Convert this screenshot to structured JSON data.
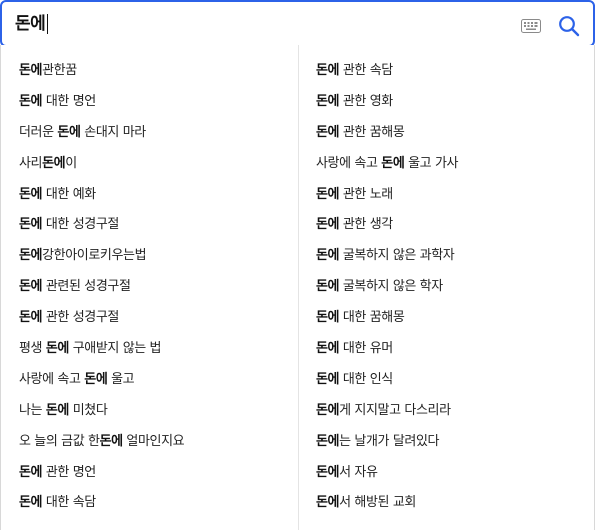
{
  "search": {
    "query": "돈에",
    "keyboard_icon": "keyboard-icon",
    "search_icon": "magnifier-icon",
    "accent_color": "#2c62e8"
  },
  "suggestions": {
    "left": [
      {
        "pre": "",
        "match": "돈에",
        "post": "관한꿈"
      },
      {
        "pre": "",
        "match": "돈에",
        "post": " 대한 명언"
      },
      {
        "pre": "더러운 ",
        "match": "돈에",
        "post": " 손대지 마라"
      },
      {
        "pre": "사리",
        "match": "돈에",
        "post": "이"
      },
      {
        "pre": "",
        "match": "돈에",
        "post": " 대한 예화"
      },
      {
        "pre": "",
        "match": "돈에",
        "post": " 대한 성경구절"
      },
      {
        "pre": "",
        "match": "돈에",
        "post": "강한아이로키우는법"
      },
      {
        "pre": "",
        "match": "돈에",
        "post": " 관련된 성경구절"
      },
      {
        "pre": "",
        "match": "돈에",
        "post": " 관한 성경구절"
      },
      {
        "pre": "평생 ",
        "match": "돈에",
        "post": " 구애받지 않는 법"
      },
      {
        "pre": "사랑에 속고 ",
        "match": "돈에",
        "post": " 울고"
      },
      {
        "pre": "나는 ",
        "match": "돈에",
        "post": " 미쳤다"
      },
      {
        "pre": "오 늘의 금값 한",
        "match": "돈에",
        "post": " 얼마인지요"
      },
      {
        "pre": "",
        "match": "돈에",
        "post": " 관한 명언"
      },
      {
        "pre": "",
        "match": "돈에",
        "post": " 대한 속담"
      }
    ],
    "right": [
      {
        "pre": "",
        "match": "돈에",
        "post": " 관한 속담"
      },
      {
        "pre": "",
        "match": "돈에",
        "post": " 관한 영화"
      },
      {
        "pre": "",
        "match": "돈에",
        "post": " 관한 꿈해몽"
      },
      {
        "pre": "사랑에 속고 ",
        "match": "돈에",
        "post": " 울고 가사"
      },
      {
        "pre": "",
        "match": "돈에",
        "post": " 관한 노래"
      },
      {
        "pre": "",
        "match": "돈에",
        "post": " 관한 생각"
      },
      {
        "pre": "",
        "match": "돈에",
        "post": " 굴복하지 않은 과학자"
      },
      {
        "pre": "",
        "match": "돈에",
        "post": " 굴복하지 않은 학자"
      },
      {
        "pre": "",
        "match": "돈에",
        "post": " 대한 꿈해몽"
      },
      {
        "pre": "",
        "match": "돈에",
        "post": " 대한 유머"
      },
      {
        "pre": "",
        "match": "돈에",
        "post": " 대한 인식"
      },
      {
        "pre": "",
        "match": "돈에",
        "post": "게 지지말고 다스리라"
      },
      {
        "pre": "",
        "match": "돈에",
        "post": "는 날개가 달려있다"
      },
      {
        "pre": "",
        "match": "돈에",
        "post": "서 자유"
      },
      {
        "pre": "",
        "match": "돈에",
        "post": "서 해방된 교회"
      }
    ]
  }
}
